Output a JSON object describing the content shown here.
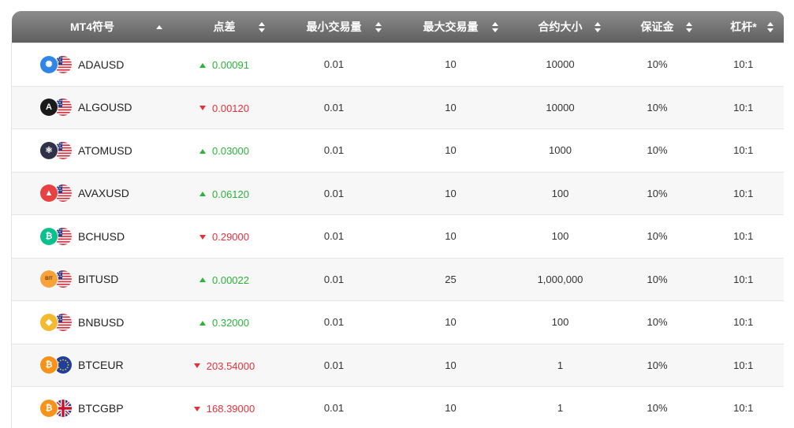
{
  "columns": [
    {
      "label": "MT4符号",
      "sort": "asc"
    },
    {
      "label": "点差",
      "sort": "both"
    },
    {
      "label": "最小交易量",
      "sort": "both"
    },
    {
      "label": "最大交易量",
      "sort": "both"
    },
    {
      "label": "合约大小",
      "sort": "both"
    },
    {
      "label": "保证金",
      "sort": "both"
    },
    {
      "label": "杠杆*",
      "sort": "both"
    }
  ],
  "rows": [
    {
      "symbol": "ADAUSD",
      "coin_icon": "cardano-icon",
      "coin_color": "#2f86e8",
      "coin_glyph": "✺",
      "quote_flag": "us-flag-icon",
      "direction": "up",
      "spread": "0.00091",
      "min": "0.01",
      "max": "10",
      "contract": "10000",
      "margin": "10%",
      "leverage": "10:1"
    },
    {
      "symbol": "ALGOUSD",
      "coin_icon": "algorand-icon",
      "coin_color": "#1b1b1b",
      "coin_glyph": "A",
      "quote_flag": "us-flag-icon",
      "direction": "down",
      "spread": "0.00120",
      "min": "0.01",
      "max": "10",
      "contract": "10000",
      "margin": "10%",
      "leverage": "10:1"
    },
    {
      "symbol": "ATOMUSD",
      "coin_icon": "cosmos-icon",
      "coin_color": "#2e3148",
      "coin_glyph": "⚛",
      "quote_flag": "us-flag-icon",
      "direction": "up",
      "spread": "0.03000",
      "min": "0.01",
      "max": "10",
      "contract": "1000",
      "margin": "10%",
      "leverage": "10:1"
    },
    {
      "symbol": "AVAXUSD",
      "coin_icon": "avalanche-icon",
      "coin_color": "#e84142",
      "coin_glyph": "▲",
      "quote_flag": "us-flag-icon",
      "direction": "up",
      "spread": "0.06120",
      "min": "0.01",
      "max": "10",
      "contract": "100",
      "margin": "10%",
      "leverage": "10:1"
    },
    {
      "symbol": "BCHUSD",
      "coin_icon": "bitcoin-cash-icon",
      "coin_color": "#0ac18e",
      "coin_glyph": "₿",
      "quote_flag": "us-flag-icon",
      "direction": "down",
      "spread": "0.29000",
      "min": "0.01",
      "max": "10",
      "contract": "100",
      "margin": "10%",
      "leverage": "10:1"
    },
    {
      "symbol": "BITUSD",
      "coin_icon": "bit-icon",
      "coin_color": "#f7a23b",
      "coin_glyph": "BIT",
      "quote_flag": "us-flag-icon",
      "direction": "up",
      "spread": "0.00022",
      "min": "0.01",
      "max": "25",
      "contract": "1,000,000",
      "margin": "10%",
      "leverage": "10:1"
    },
    {
      "symbol": "BNBUSD",
      "coin_icon": "binance-icon",
      "coin_color": "#f3ba2f",
      "coin_glyph": "◆",
      "quote_flag": "us-flag-icon",
      "direction": "up",
      "spread": "0.32000",
      "min": "0.01",
      "max": "10",
      "contract": "100",
      "margin": "10%",
      "leverage": "10:1"
    },
    {
      "symbol": "BTCEUR",
      "coin_icon": "bitcoin-icon",
      "coin_color": "#f7931a",
      "coin_glyph": "₿",
      "quote_flag": "eu-flag-icon",
      "direction": "down",
      "spread": "203.54000",
      "min": "0.01",
      "max": "10",
      "contract": "1",
      "margin": "10%",
      "leverage": "10:1"
    },
    {
      "symbol": "BTCGBP",
      "coin_icon": "bitcoin-icon",
      "coin_color": "#f7931a",
      "coin_glyph": "₿",
      "quote_flag": "uk-flag-icon",
      "direction": "down",
      "spread": "168.39000",
      "min": "0.01",
      "max": "10",
      "contract": "1",
      "margin": "10%",
      "leverage": "10:1"
    }
  ],
  "colors": {
    "up": "#2bb33a",
    "down": "#e5303b",
    "header_top": "#8c8c8c",
    "header_bottom": "#5f5f5f"
  }
}
